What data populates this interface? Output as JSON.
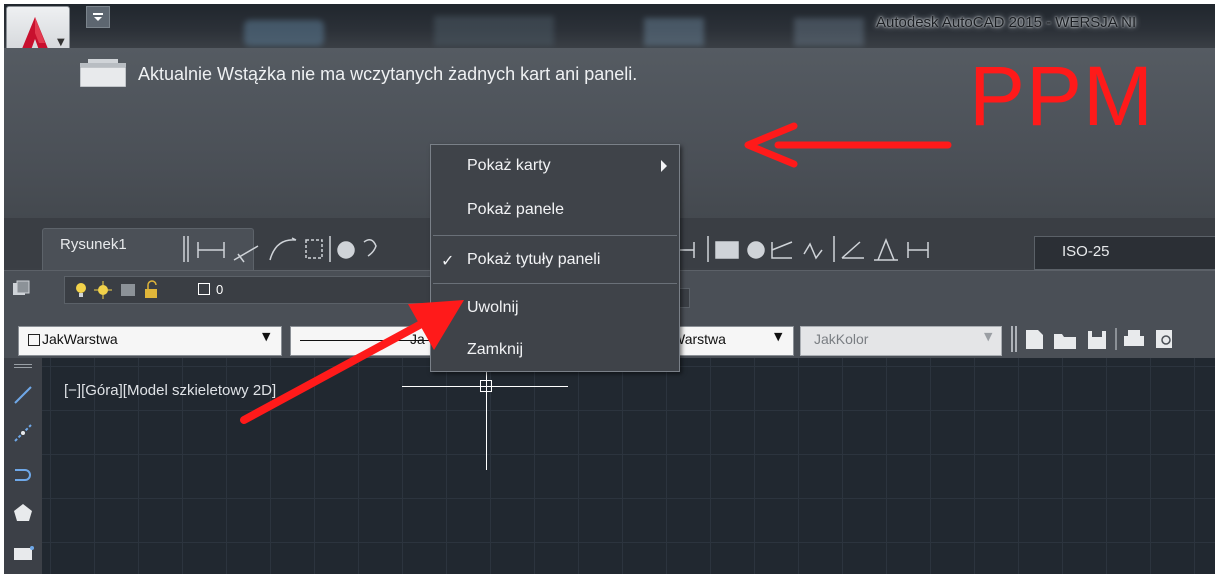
{
  "window": {
    "title": "Autodesk AutoCAD 2015 - WERSJA NI"
  },
  "application_button": {
    "icon": "autocad-logo-icon"
  },
  "ribbon": {
    "message": "Aktualnie Wstążka nie ma wczytanych żadnych kart ani paneli."
  },
  "annotation": {
    "label": "PPM",
    "color": "#ff1a1a"
  },
  "tabs": [
    {
      "label": "Rysunek1"
    }
  ],
  "dimension_style": {
    "value": "ISO-25"
  },
  "layer": {
    "current": "0"
  },
  "properties": {
    "color": "JakWarstwa",
    "linetype_tail": "Ja",
    "lineweight": "Warstwa",
    "plotstyle": "JakKolor"
  },
  "viewport": {
    "label": "[−][Góra][Model szkieletowy 2D]"
  },
  "context_menu": {
    "items": [
      {
        "label": "Pokaż karty",
        "submenu": true
      },
      {
        "label": "Pokaż panele"
      },
      {
        "label": "Pokaż tytuły paneli",
        "checked": true
      },
      {
        "label": "Uwolnij"
      },
      {
        "label": "Zamknij"
      }
    ]
  },
  "colors": {
    "background_dark": "#3b3f45",
    "canvas": "#212830",
    "menu_bg": "#3f4349",
    "accent_red": "#ff1a1a",
    "autocad_red": "#c8102e"
  }
}
